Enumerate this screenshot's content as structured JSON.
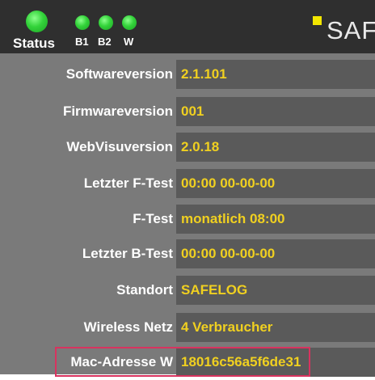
{
  "header": {
    "status_label": "Status",
    "indicators": [
      "B1",
      "B2",
      "W"
    ],
    "brand_text": "SAF",
    "colors": {
      "led": "#33d33a",
      "brand_mark": "#f2e600",
      "value_text": "#f0d020",
      "highlight": "#d8335f"
    }
  },
  "info": {
    "rows": [
      {
        "label": "Softwareversion",
        "value": "2.1.101"
      },
      {
        "label": "Firmwareversion",
        "value": "001"
      },
      {
        "label": "WebVisuversion",
        "value": "2.0.18"
      },
      {
        "label": "Letzter F-Test",
        "value": "00:00  00-00-00"
      },
      {
        "label": "F-Test",
        "value": "monatlich 08:00"
      },
      {
        "label": "Letzter B-Test",
        "value": "00:00  00-00-00"
      },
      {
        "label": "Standort",
        "value": "SAFELOG"
      },
      {
        "label": "Wireless Netz",
        "value": "4 Verbraucher"
      },
      {
        "label": "Mac-Adresse W",
        "value": "18016c56a5f6de31"
      }
    ]
  }
}
